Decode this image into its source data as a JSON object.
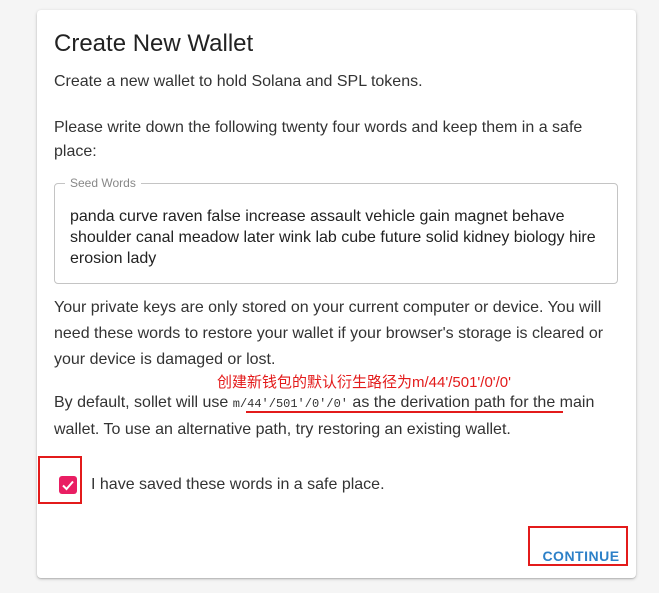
{
  "dialog": {
    "title": "Create New Wallet",
    "subtitle": "Create a new wallet to hold Solana and SPL tokens.",
    "instruction": "Please write down the following twenty four words and keep them in a safe place:",
    "seed_field": {
      "label": "Seed Words",
      "value": "panda curve raven false increase assault vehicle gain magnet behave shoulder canal meadow later wink lab cube future solid kidney biology hire erosion lady"
    },
    "info_text": "Your private keys are only stored on your current computer or device. You will need these words to restore your wallet if your browser's storage is cleared or your device is damaged or lost.",
    "default_text": {
      "prefix": "By default, sollet will use ",
      "path": "m/44'/501'/0'/0'",
      "middle": " as the derivation path",
      "suffix": " for the main wallet. To use an alternative path, try restoring an existing wallet."
    },
    "checkbox": {
      "checked": true,
      "label": "I have saved these words in a safe place."
    },
    "continue_label": "CONTINUE"
  },
  "annotation": {
    "text": "创建新钱包的默认衍生路径为m/44'/501'/0'/0'",
    "color": "#e31b1b"
  },
  "colors": {
    "accent": "#e91e63",
    "primary": "#2c80c8"
  }
}
